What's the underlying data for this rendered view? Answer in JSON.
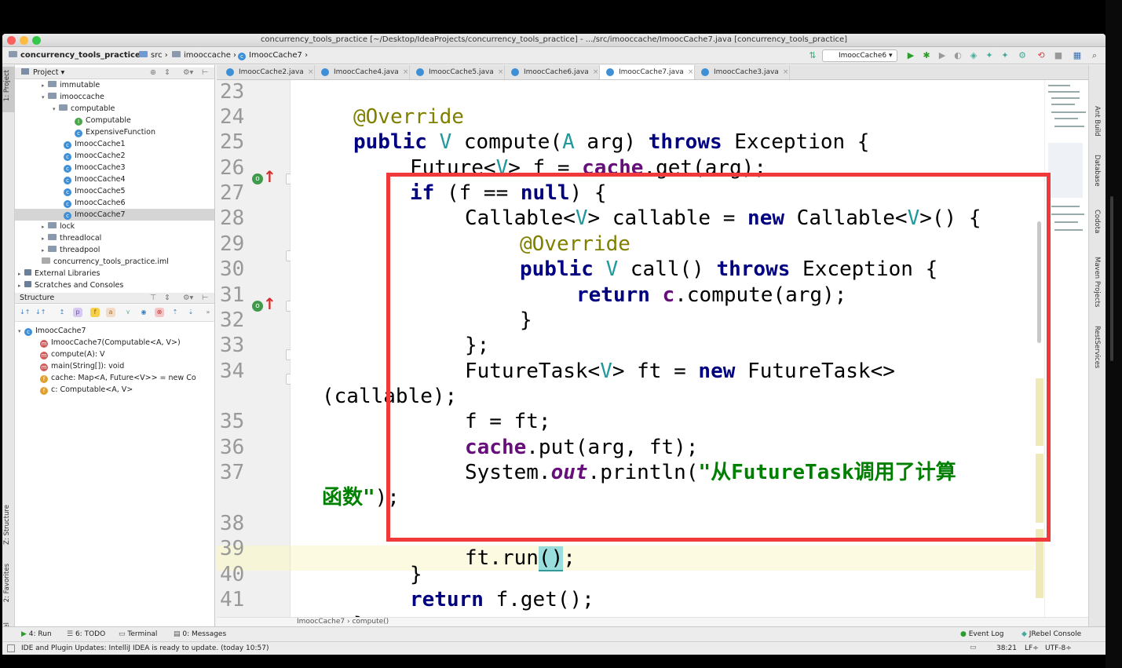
{
  "window": {
    "title": "concurrency_tools_practice [~/Desktop/IdeaProjects/concurrency_tools_practice] - .../src/imooccache/ImoocCache7.java [concurrency_tools_practice]"
  },
  "navbar": {
    "crumbs": [
      "concurrency_tools_practice",
      "src",
      "imooccache",
      "ImoocCache7"
    ],
    "run_config": "ImoocCache6"
  },
  "left_tabs": [
    "1: Project",
    "Z: Structure",
    "2: Favorites",
    "JRebel"
  ],
  "right_tabs": [
    "Ant Build",
    "Database",
    "Codota",
    "Maven Projects",
    "RestServices"
  ],
  "project": {
    "header": "Project",
    "tree": [
      {
        "label": "immutable",
        "kind": "folder"
      },
      {
        "label": "imooccache",
        "kind": "folder"
      },
      {
        "label": "computable",
        "kind": "folder"
      },
      {
        "label": "Computable",
        "kind": "iface"
      },
      {
        "label": "ExpensiveFunction",
        "kind": "class"
      },
      {
        "label": "ImoocCache1",
        "kind": "class"
      },
      {
        "label": "ImoocCache2",
        "kind": "class"
      },
      {
        "label": "ImoocCache3",
        "kind": "class"
      },
      {
        "label": "ImoocCache4",
        "kind": "class"
      },
      {
        "label": "ImoocCache5",
        "kind": "class"
      },
      {
        "label": "ImoocCache6",
        "kind": "class"
      },
      {
        "label": "ImoocCache7",
        "kind": "class"
      },
      {
        "label": "lock",
        "kind": "folder"
      },
      {
        "label": "threadlocal",
        "kind": "folder"
      },
      {
        "label": "threadpool",
        "kind": "folder"
      },
      {
        "label": "concurrency_tools_practice.iml",
        "kind": "file"
      },
      {
        "label": "External Libraries",
        "kind": "lib"
      },
      {
        "label": "Scratches and Consoles",
        "kind": "lib"
      }
    ]
  },
  "structure": {
    "header": "Structure",
    "root": "ImoocCache7",
    "members": [
      {
        "label": "ImoocCache7(Computable<A, V>)",
        "kind": "method"
      },
      {
        "label": "compute(A): V",
        "kind": "method"
      },
      {
        "label": "main(String[]): void",
        "kind": "method"
      },
      {
        "label": "cache: Map<A, Future<V>> = new Co",
        "kind": "field"
      },
      {
        "label": "c: Computable<A, V>",
        "kind": "field"
      }
    ]
  },
  "editor": {
    "tabs": [
      "ImoocCache2.java",
      "ImoocCache4.java",
      "ImoocCache5.java",
      "ImoocCache6.java",
      "ImoocCache7.java",
      "ImoocCache3.java"
    ],
    "active_tab": "ImoocCache7.java",
    "line_numbers": [
      "23",
      "24",
      "25",
      "26",
      "27",
      "28",
      "29",
      "30",
      "31",
      "32",
      "33",
      "34",
      "35",
      "36",
      "37",
      "38",
      "39",
      "40",
      "41"
    ],
    "breadcrumb": [
      "ImoocCache7",
      "compute()"
    ]
  },
  "toolwindows": [
    "4: Run",
    "6: TODO",
    "Terminal",
    "0: Messages",
    "Event Log",
    "JRebel Console"
  ],
  "status": {
    "message": "IDE and Plugin Updates: IntelliJ IDEA is ready to update. (today 10:57)",
    "position": "38:21",
    "line_sep": "LF÷",
    "encoding": "UTF-8÷"
  },
  "colors": {
    "annotation_box": "#f0393b",
    "keyword": "#000080",
    "annotation": "#808000",
    "type_param": "#20999d",
    "string": "#008000"
  }
}
